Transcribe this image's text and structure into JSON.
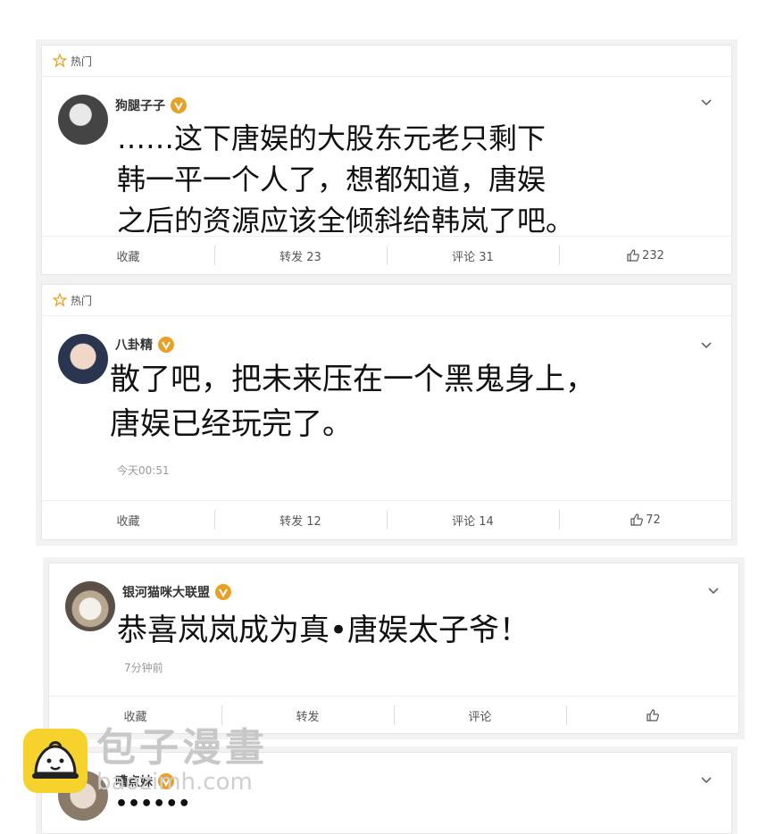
{
  "posts": [
    {
      "hot_label": "热门",
      "username": "狗腿子子",
      "content_lines": [
        "……这下唐娱的大股东元老只剩下",
        "韩一平一个人了，想都知道，唐娱",
        "之后的资源应该全倾斜给韩岚了吧。"
      ],
      "actions": {
        "favorite": "收藏",
        "repost": "转发 23",
        "comment": "评论 31",
        "like": "232"
      }
    },
    {
      "hot_label": "热门",
      "username": "八卦精",
      "content_lines": [
        "散了吧，把未来压在一个黑鬼身上，",
        "唐娱已经玩完了。"
      ],
      "time": "今天00:51",
      "actions": {
        "favorite": "收藏",
        "repost": "转发 12",
        "comment": "评论 14",
        "like": "72"
      }
    },
    {
      "username": "银河猫咪大联盟",
      "content_lines": [
        "恭喜岚岚成为真•唐娱太子爷！"
      ],
      "time": "7分钟前",
      "actions": {
        "favorite": "收藏",
        "repost": "转发",
        "comment": "评论",
        "like": ""
      }
    },
    {
      "username": "嘈点妹",
      "content_lines": [
        "••••••"
      ]
    }
  ],
  "watermark": {
    "name": "包子漫畫",
    "url": "baozimh.com"
  },
  "colors": {
    "badge": "#e8a126",
    "hot_star": "#f0a020",
    "watermark_logo": "#f7d12c"
  },
  "icons": [
    "star-icon",
    "verified-badge-icon",
    "chevron-down-icon",
    "thumbs-up-icon"
  ]
}
